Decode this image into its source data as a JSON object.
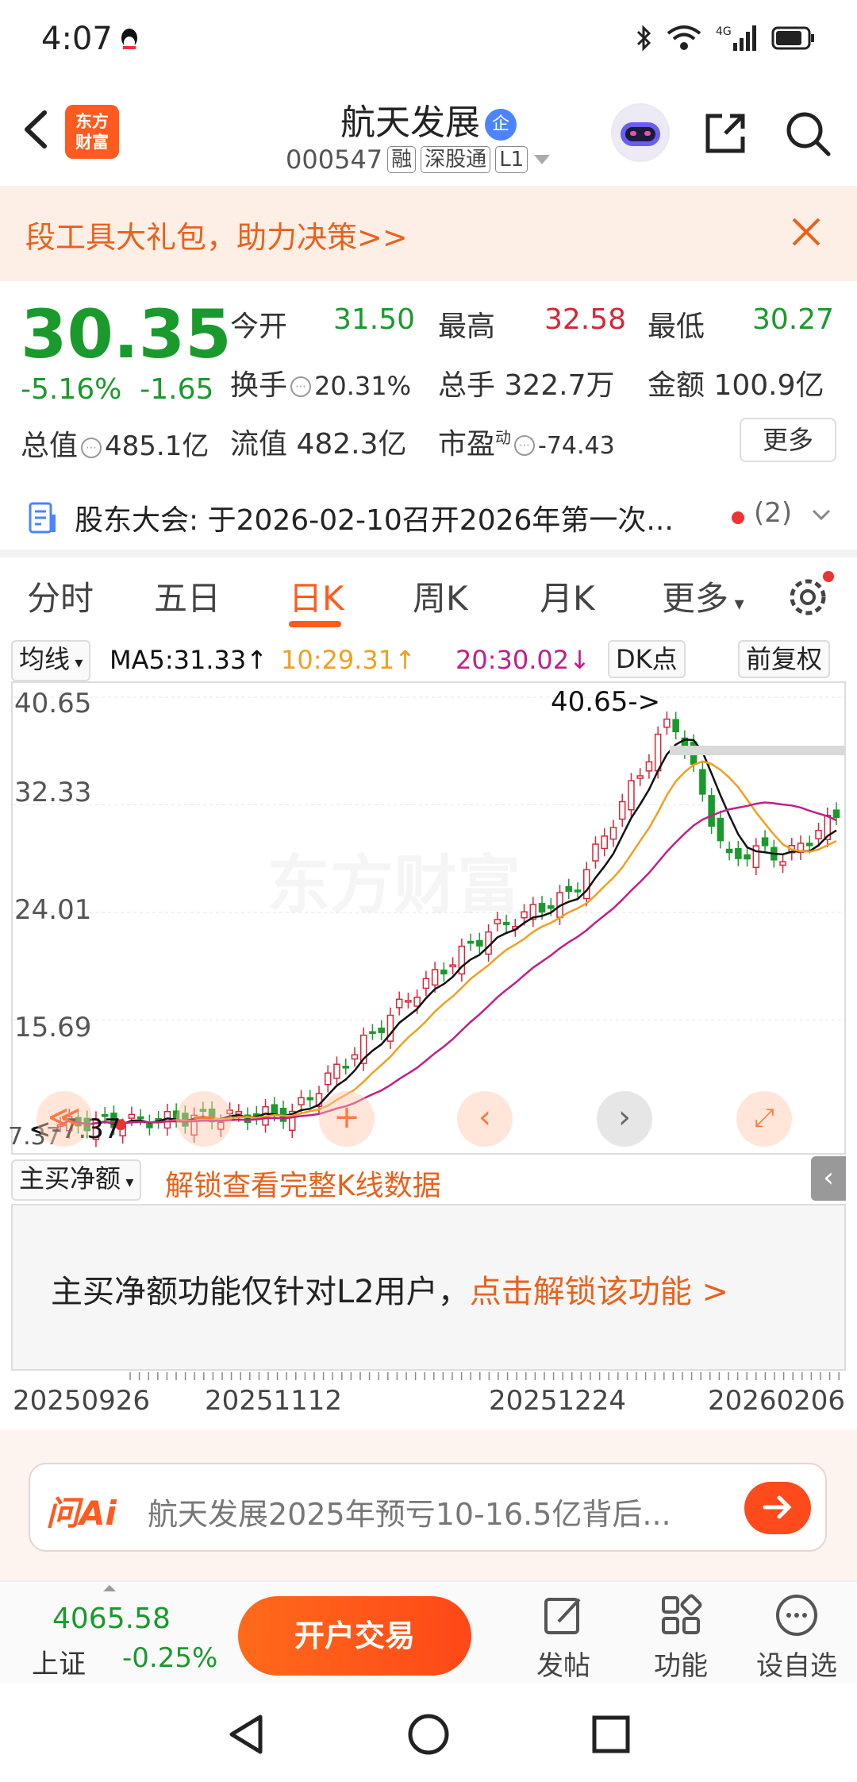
{
  "status_bar": {
    "time": "4:07",
    "network": "4G"
  },
  "header": {
    "brand_logo": "东方\n财富",
    "stock_name": "航天发展",
    "badge": "企",
    "code": "000547",
    "tags": [
      "融",
      "深股通",
      "L1"
    ]
  },
  "banner": {
    "text": "段工具大礼包，助力决策>>"
  },
  "quote": {
    "price": "30.35",
    "change_pct": "-5.16%",
    "change_abs": "-1.65",
    "total_value_label": "总值",
    "total_value": "485.1亿",
    "open_label": "今开",
    "open": "31.50",
    "high_label": "最高",
    "high": "32.58",
    "low_label": "最低",
    "low": "30.27",
    "turnover_label": "换手",
    "turnover": "20.31%",
    "volume_label": "总手",
    "volume": "322.7万",
    "amount_label": "金额",
    "amount": "100.9亿",
    "float_label": "流值",
    "float_value": "482.3亿",
    "pe_label": "市盈",
    "pe_sup": "动",
    "pe": "-74.43",
    "more_label": "更多"
  },
  "announcement": {
    "title": "股东大会:",
    "text": "于2026-02-10召开2026年第一次...",
    "count": "(2)"
  },
  "tabs": [
    "分时",
    "五日",
    "日K",
    "周K",
    "月K",
    "更多"
  ],
  "active_tab": "日K",
  "ma_bar": {
    "selector": "均线",
    "ma5": "MA5:31.33",
    "ma10": "10:29.31",
    "ma20": "20:30.02",
    "dk": "DK点",
    "adjust": "前复权"
  },
  "chart": {
    "y_labels": [
      "40.65",
      "32.33",
      "24.01",
      "15.69",
      "7.37"
    ],
    "max_label": "40.65->",
    "min_label": "<-7.37",
    "watermark": "东方财富"
  },
  "sub_panel": {
    "selector": "主买净额",
    "unlock_text": "解锁查看完整K线数据",
    "message": "主买净额功能仅针对L2用户，",
    "link": "点击解锁该功能 >"
  },
  "dates": [
    "20250926",
    "20251112",
    "20251224",
    "20260206"
  ],
  "ai": {
    "logo": "问Ai",
    "question": "航天发展2025年预亏10-16.5亿背后..."
  },
  "toolbar": {
    "index_value": "4065.58",
    "index_name": "上证",
    "index_change": "-0.25%",
    "open_account": "开户交易",
    "post": "发帖",
    "function": "功能",
    "watch": "设自选"
  },
  "colors": {
    "up": "#d6263a",
    "down": "#1a9a2c",
    "accent": "#ff5a1f",
    "ma5": "#111111",
    "ma10": "#f0a020",
    "ma20": "#c0208a"
  }
}
